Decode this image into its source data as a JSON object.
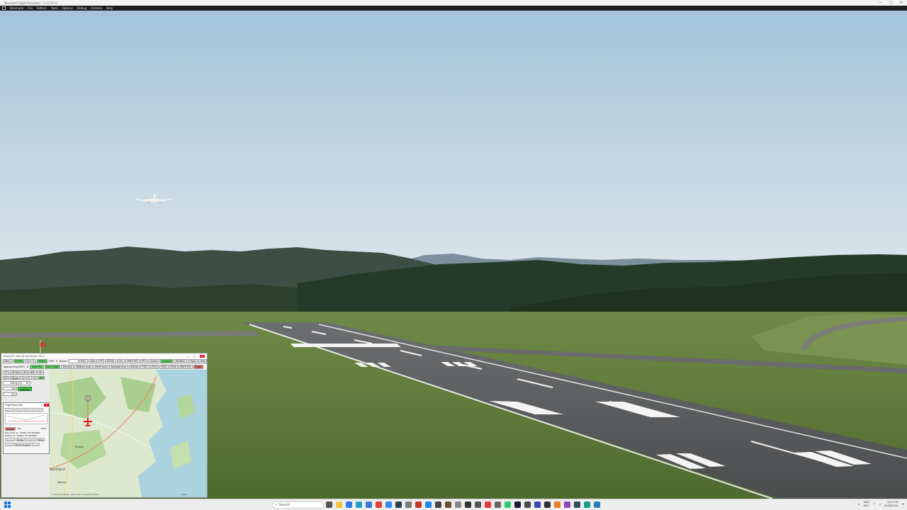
{
  "window": {
    "title": "Microsoft Flight Simulator - 1.37.19.0",
    "controls": [
      "—",
      "▢",
      "✕"
    ]
  },
  "menubar": {
    "items": [
      "Devmode",
      "File",
      "Editors",
      "Tools",
      "Options",
      "Debug",
      "Camera",
      "Help"
    ]
  },
  "navmap": {
    "title": "Pilot2ATC Map @ Northeast 2024",
    "toolbar1": [
      "Menu",
      "On Tar",
      "D",
      "V",
      "Online",
      "FOM",
      "S",
      "Airport",
      "",
      "Rwy",
      "Gate",
      "FP",
      "3DCity",
      "City",
      "MSFS POI",
      "POI",
      "Airport",
      "Airplane",
      "Weather",
      "Flight",
      "Help"
    ],
    "toolbar2": [
      "Approaching ENTO",
      "ft",
      "Save POI",
      "Save Flight",
      "Big Arpt",
      "Medium Arpt",
      "Small Arpt",
      "Bespoke Arpt",
      "3DCity",
      "POI1",
      "POI2",
      "POI3",
      "POI4",
      "MSFS POI",
      "Flight"
    ],
    "toolbar3": [
      "ST",
      "AP Set",
      "AP",
      "AGL",
      "AC"
    ],
    "toolbar4": [
      "PT",
      "Pause",
      "C",
      "S",
      "D",
      "RT"
    ],
    "altitude": "5965",
    "time": "18 : 59",
    "speed": "133",
    "heading": "271",
    "start_button": "(Re)Start",
    "map_labels": {
      "town": "Sandefjord",
      "town2": "Stokke",
      "town3": "Tjølling"
    },
    "map_footer": "© OpenStreetMap - Map data © OpenStreetMap",
    "map_scale": "2 km"
  },
  "recorder": {
    "title": "Flight Recorder",
    "btn_record": "Record",
    "btn_stop": "Stop",
    "btn_stop_recording": "Stop Recording",
    "btn_repeat": "Repeat",
    "value1": "951",
    "value2": "1802",
    "recorded_as": "Recorded as : PMDG 737-800BCF",
    "replay_as": "Replay as : PMDG 737-800BCF",
    "btn_replay": "Replay",
    "btn_pause": "Pause",
    "btn_rewind": "Rewind",
    "btn_stop2": "Stop",
    "btn_save": "Save",
    "btn_shortcut": "Shortcut keys",
    "btn_load": "Load"
  },
  "taskbar": {
    "search_placeholder": "Search",
    "lang": "ENG",
    "lang2": "INTL",
    "time": "8:00 PM",
    "date": "8/18/2024"
  },
  "colors": {
    "sky_top": "#a6c6db",
    "sky_bottom": "#d8e3ea",
    "grass": "#5e7a3a",
    "runway": "#5c5e5f"
  }
}
